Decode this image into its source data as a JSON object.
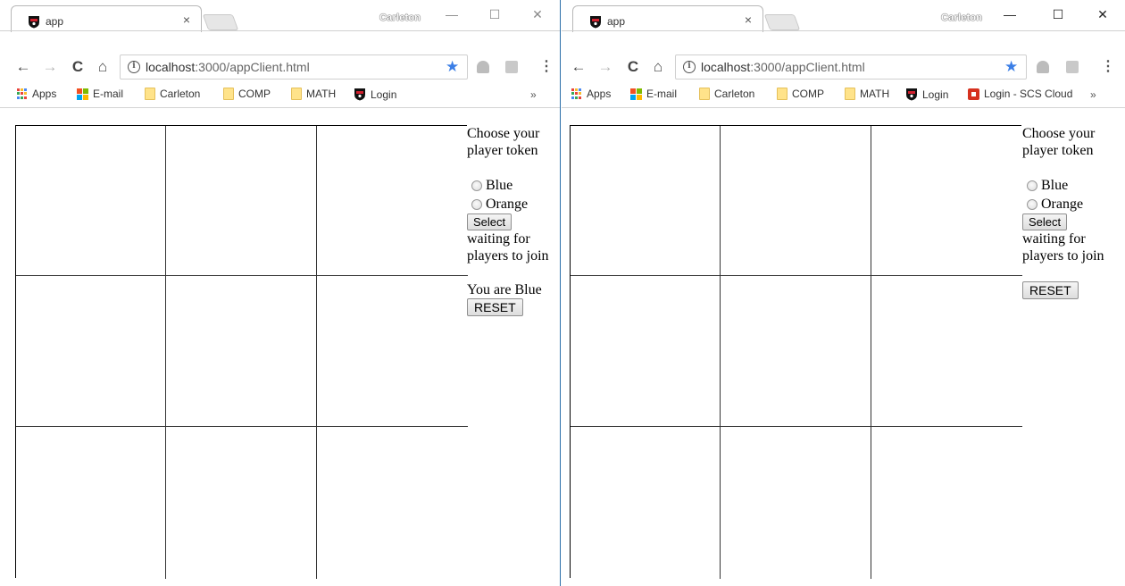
{
  "windows": [
    {
      "id": "left",
      "profile": "Carleton",
      "tab": {
        "title": "app",
        "close": "×"
      },
      "controls": {
        "minimize": "—",
        "maximize": "☐",
        "close": "✕"
      },
      "nav": {
        "back": "←",
        "forward": "→",
        "reload": "C",
        "home": "⌂"
      },
      "address": {
        "host": "localhost",
        "path": ":3000/appClient.html"
      },
      "bookmarks": [
        "Apps",
        "E-mail",
        "Carleton",
        "COMP",
        "MATH",
        "Login"
      ],
      "bookmarks_more": "»",
      "panel": {
        "prompt": "Choose your player token",
        "options": [
          "Blue",
          "Orange"
        ],
        "select_label": "Select",
        "status": "waiting for players to join",
        "assignment": "You are Blue",
        "reset_label": "RESET"
      }
    },
    {
      "id": "right",
      "profile": "Carleton",
      "tab": {
        "title": "app",
        "close": "×"
      },
      "controls": {
        "minimize": "—",
        "maximize": "☐",
        "close": "✕"
      },
      "nav": {
        "back": "←",
        "forward": "→",
        "reload": "C",
        "home": "⌂"
      },
      "address": {
        "host": "localhost",
        "path": ":3000/appClient.html"
      },
      "bookmarks": [
        "Apps",
        "E-mail",
        "Carleton",
        "COMP",
        "MATH",
        "Login",
        "Login - SCS Cloud"
      ],
      "bookmarks_more": "»",
      "panel": {
        "prompt": "Choose your player token",
        "options": [
          "Blue",
          "Orange"
        ],
        "select_label": "Select",
        "status": "waiting for players to join",
        "assignment": "",
        "reset_label": "RESET"
      }
    }
  ],
  "colors": {
    "star": "#3b7ee6",
    "window_border": "#2b6ea8",
    "folder": "#ffe38a",
    "scs_red": "#d6311f"
  },
  "icons": [
    "carleton-favicon",
    "info-icon",
    "star-icon",
    "drive-icon",
    "pdf-icon",
    "apps-icon",
    "ms-logo-icon",
    "folder-icon",
    "scs-cloud-icon"
  ]
}
